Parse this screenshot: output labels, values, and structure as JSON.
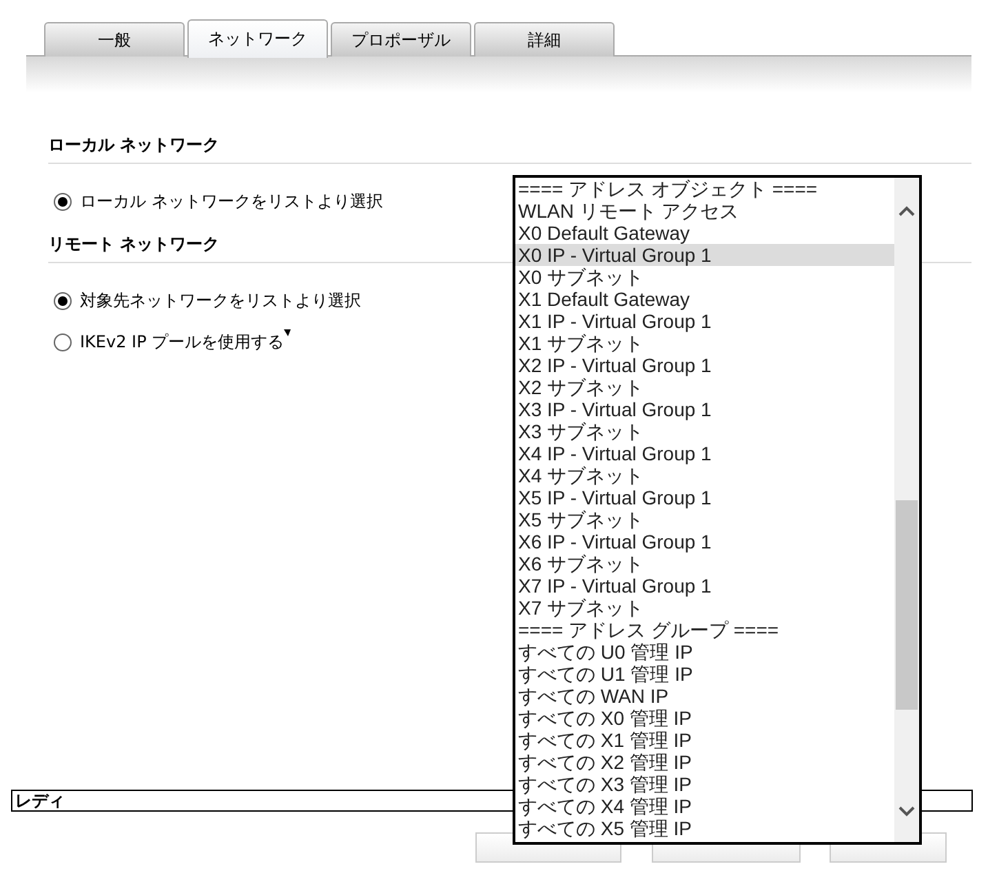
{
  "tabs": [
    {
      "label": "一般",
      "selected": false
    },
    {
      "label": "ネットワーク",
      "selected": true
    },
    {
      "label": "プロポーザル",
      "selected": false
    },
    {
      "label": "詳細",
      "selected": false
    }
  ],
  "sections": [
    {
      "heading": "ローカル ネットワーク",
      "options": [
        {
          "label": "ローカル ネットワークをリストより選択",
          "selected": true
        }
      ]
    },
    {
      "heading": "リモート ネットワーク",
      "options": [
        {
          "label": "対象先ネットワークをリストより選択",
          "selected": true
        },
        {
          "label": "IKEv2 IP プールを使用する",
          "selected": false
        }
      ]
    }
  ],
  "status_bar": {
    "text": "レディ"
  },
  "footer_buttons": [
    {
      "kind": "button"
    },
    {
      "kind": "button"
    },
    {
      "kind": "button"
    }
  ],
  "dropdown_list": {
    "items": [
      {
        "label": "==== アドレス オブジェクト ====",
        "selected": false
      },
      {
        "label": "WLAN リモート アクセス",
        "selected": false
      },
      {
        "label": "X0 Default Gateway",
        "selected": false
      },
      {
        "label": "X0 IP - Virtual Group 1",
        "selected": true
      },
      {
        "label": "X0 サブネット",
        "selected": false
      },
      {
        "label": "X1 Default Gateway",
        "selected": false
      },
      {
        "label": "X1 IP - Virtual Group 1",
        "selected": false
      },
      {
        "label": "X1 サブネット",
        "selected": false
      },
      {
        "label": "X2 IP - Virtual Group 1",
        "selected": false
      },
      {
        "label": "X2 サブネット",
        "selected": false
      },
      {
        "label": "X3 IP - Virtual Group 1",
        "selected": false
      },
      {
        "label": "X3 サブネット",
        "selected": false
      },
      {
        "label": "X4 IP - Virtual Group 1",
        "selected": false
      },
      {
        "label": "X4 サブネット",
        "selected": false
      },
      {
        "label": "X5 IP - Virtual Group 1",
        "selected": false
      },
      {
        "label": "X5 サブネット",
        "selected": false
      },
      {
        "label": "X6 IP - Virtual Group 1",
        "selected": false
      },
      {
        "label": "X6 サブネット",
        "selected": false
      },
      {
        "label": "X7 IP - Virtual Group 1",
        "selected": false
      },
      {
        "label": "X7 サブネット",
        "selected": false
      },
      {
        "label": "==== アドレス グループ ====",
        "selected": false
      },
      {
        "label": "すべての U0 管理 IP",
        "selected": false
      },
      {
        "label": "すべての U1 管理 IP",
        "selected": false
      },
      {
        "label": "すべての WAN IP",
        "selected": false
      },
      {
        "label": "すべての X0 管理 IP",
        "selected": false
      },
      {
        "label": "すべての X1 管理 IP",
        "selected": false
      },
      {
        "label": "すべての X2 管理 IP",
        "selected": false
      },
      {
        "label": "すべての X3 管理 IP",
        "selected": false
      },
      {
        "label": "すべての X4 管理 IP",
        "selected": false
      },
      {
        "label": "すべての X5 管理 IP",
        "selected": false
      }
    ]
  }
}
